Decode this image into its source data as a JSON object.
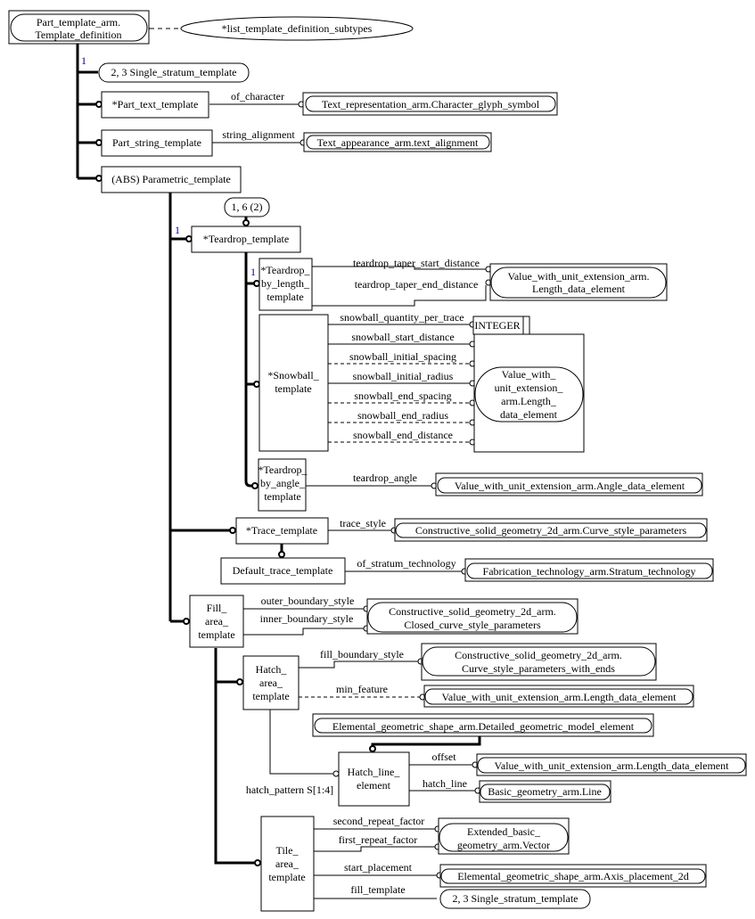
{
  "diagram": {
    "title": "Part_template_arm.Template_definition EXPRESS-G diagram",
    "root": {
      "lines": [
        "Part_template_arm.",
        "Template_definition"
      ]
    },
    "subtypes_ref": {
      "label": "*list_template_definition_subtypes"
    },
    "entities": {
      "single_stratum_ref_top": {
        "label": "2, 3 Single_stratum_template"
      },
      "part_text_template": {
        "lines": [
          "*Part_text_template"
        ]
      },
      "part_string_template": {
        "lines": [
          "Part_string_template"
        ]
      },
      "parametric_template": {
        "lines": [
          "(ABS) Parametric_template"
        ]
      },
      "oneof_ref": {
        "label": "1, 6 (2)"
      },
      "teardrop_template": {
        "lines": [
          "*Teardrop_template"
        ]
      },
      "teardrop_by_length": {
        "lines": [
          "*Teardrop_",
          "by_length_",
          "template"
        ]
      },
      "snowball_template": {
        "lines": [
          "*Snowball_",
          "template"
        ]
      },
      "teardrop_by_angle": {
        "lines": [
          "*Teardrop_",
          "by_angle_",
          "template"
        ]
      },
      "trace_template": {
        "lines": [
          "*Trace_template"
        ]
      },
      "default_trace_template": {
        "lines": [
          "Default_trace_template"
        ]
      },
      "fill_area_template": {
        "lines": [
          "Fill_",
          "area_",
          "template"
        ]
      },
      "hatch_area_template": {
        "lines": [
          "Hatch_",
          "area_",
          "template"
        ]
      },
      "hatch_line_element": {
        "lines": [
          "Hatch_line_",
          "element"
        ]
      },
      "tile_area_template": {
        "lines": [
          "Tile_",
          "area_",
          "template"
        ]
      },
      "integer_type": {
        "label": "INTEGER"
      },
      "single_stratum_ref_bottom": {
        "label": "2, 3 Single_stratum_template"
      }
    },
    "references": {
      "character_glyph_symbol": {
        "lines": [
          "Text_representation_arm.Character_glyph_symbol"
        ]
      },
      "text_alignment": {
        "lines": [
          "Text_appearance_arm.text_alignment"
        ]
      },
      "length_data_element_a": {
        "lines": [
          "Value_with_unit_extension_arm.",
          "Length_data_element"
        ]
      },
      "length_data_element_b": {
        "lines": [
          "Value_with_",
          "unit_extension_",
          "arm.Length_",
          "data_element"
        ]
      },
      "angle_data_element": {
        "lines": [
          "Value_with_unit_extension_arm.Angle_data_element"
        ]
      },
      "curve_style_parameters": {
        "lines": [
          "Constructive_solid_geometry_2d_arm.Curve_style_parameters"
        ]
      },
      "stratum_technology": {
        "lines": [
          "Fabrication_technology_arm.Stratum_technology"
        ]
      },
      "closed_curve_style_parameters": {
        "lines": [
          "Constructive_solid_geometry_2d_arm.",
          "Closed_curve_style_parameters"
        ]
      },
      "curve_style_parameters_with_ends": {
        "lines": [
          "Constructive_solid_geometry_2d_arm.",
          "Curve_style_parameters_with_ends"
        ]
      },
      "length_data_element_c": {
        "lines": [
          "Value_with_unit_extension_arm.Length_data_element"
        ]
      },
      "detailed_geometric_model_element": {
        "lines": [
          "Elemental_geometric_shape_arm.Detailed_geometric_model_element"
        ]
      },
      "length_data_element_d": {
        "lines": [
          "Value_with_unit_extension_arm.Length_data_element"
        ]
      },
      "basic_line": {
        "lines": [
          "Basic_geometry_arm.Line"
        ]
      },
      "vector": {
        "lines": [
          "Extended_basic_",
          "geometry_arm.Vector"
        ]
      },
      "axis_placement_2d": {
        "lines": [
          "Elemental_geometric_shape_arm.Axis_placement_2d"
        ]
      }
    },
    "attributes": {
      "of_character": "of_character",
      "string_alignment": "string_alignment",
      "teardrop_taper_start_distance": "teardrop_taper_start_distance",
      "teardrop_taper_end_distance": "teardrop_taper_end_distance",
      "snowball_quantity_per_trace": "snowball_quantity_per_trace",
      "snowball_start_distance": "snowball_start_distance",
      "snowball_initial_spacing": "snowball_initial_spacing",
      "snowball_initial_radius": "snowball_initial_radius",
      "snowball_end_spacing": "snowball_end_spacing",
      "snowball_end_radius": "snowball_end_radius",
      "snowball_end_distance": "snowball_end_distance",
      "teardrop_angle": "teardrop_angle",
      "trace_style": "trace_style",
      "of_stratum_technology": "of_stratum_technology",
      "outer_boundary_style": "outer_boundary_style",
      "inner_boundary_style": "inner_boundary_style",
      "fill_boundary_style": "fill_boundary_style",
      "min_feature": "min_feature",
      "offset": "offset",
      "hatch_line": "hatch_line",
      "hatch_pattern": "hatch_pattern S[1:4]",
      "second_repeat_factor": "second_repeat_factor",
      "first_repeat_factor": "first_repeat_factor",
      "start_placement": "start_placement",
      "fill_template": "fill_template"
    },
    "cardinalities": {
      "root_one": "1",
      "parametric_one": "1",
      "teardrop_one": "1"
    },
    "colors": {
      "line": "#000000",
      "cardinality": "#00008b",
      "background": "#ffffff"
    }
  }
}
